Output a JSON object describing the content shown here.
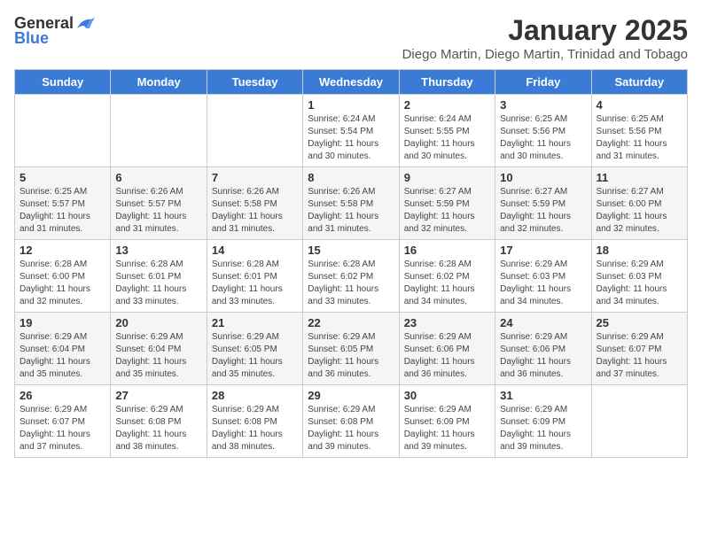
{
  "header": {
    "logo_general": "General",
    "logo_blue": "Blue",
    "month_title": "January 2025",
    "location": "Diego Martin, Diego Martin, Trinidad and Tobago"
  },
  "days_of_week": [
    "Sunday",
    "Monday",
    "Tuesday",
    "Wednesday",
    "Thursday",
    "Friday",
    "Saturday"
  ],
  "weeks": [
    [
      {
        "day": "",
        "info": ""
      },
      {
        "day": "",
        "info": ""
      },
      {
        "day": "",
        "info": ""
      },
      {
        "day": "1",
        "info": "Sunrise: 6:24 AM\nSunset: 5:54 PM\nDaylight: 11 hours and 30 minutes."
      },
      {
        "day": "2",
        "info": "Sunrise: 6:24 AM\nSunset: 5:55 PM\nDaylight: 11 hours and 30 minutes."
      },
      {
        "day": "3",
        "info": "Sunrise: 6:25 AM\nSunset: 5:56 PM\nDaylight: 11 hours and 30 minutes."
      },
      {
        "day": "4",
        "info": "Sunrise: 6:25 AM\nSunset: 5:56 PM\nDaylight: 11 hours and 31 minutes."
      }
    ],
    [
      {
        "day": "5",
        "info": "Sunrise: 6:25 AM\nSunset: 5:57 PM\nDaylight: 11 hours and 31 minutes."
      },
      {
        "day": "6",
        "info": "Sunrise: 6:26 AM\nSunset: 5:57 PM\nDaylight: 11 hours and 31 minutes."
      },
      {
        "day": "7",
        "info": "Sunrise: 6:26 AM\nSunset: 5:58 PM\nDaylight: 11 hours and 31 minutes."
      },
      {
        "day": "8",
        "info": "Sunrise: 6:26 AM\nSunset: 5:58 PM\nDaylight: 11 hours and 31 minutes."
      },
      {
        "day": "9",
        "info": "Sunrise: 6:27 AM\nSunset: 5:59 PM\nDaylight: 11 hours and 32 minutes."
      },
      {
        "day": "10",
        "info": "Sunrise: 6:27 AM\nSunset: 5:59 PM\nDaylight: 11 hours and 32 minutes."
      },
      {
        "day": "11",
        "info": "Sunrise: 6:27 AM\nSunset: 6:00 PM\nDaylight: 11 hours and 32 minutes."
      }
    ],
    [
      {
        "day": "12",
        "info": "Sunrise: 6:28 AM\nSunset: 6:00 PM\nDaylight: 11 hours and 32 minutes."
      },
      {
        "day": "13",
        "info": "Sunrise: 6:28 AM\nSunset: 6:01 PM\nDaylight: 11 hours and 33 minutes."
      },
      {
        "day": "14",
        "info": "Sunrise: 6:28 AM\nSunset: 6:01 PM\nDaylight: 11 hours and 33 minutes."
      },
      {
        "day": "15",
        "info": "Sunrise: 6:28 AM\nSunset: 6:02 PM\nDaylight: 11 hours and 33 minutes."
      },
      {
        "day": "16",
        "info": "Sunrise: 6:28 AM\nSunset: 6:02 PM\nDaylight: 11 hours and 34 minutes."
      },
      {
        "day": "17",
        "info": "Sunrise: 6:29 AM\nSunset: 6:03 PM\nDaylight: 11 hours and 34 minutes."
      },
      {
        "day": "18",
        "info": "Sunrise: 6:29 AM\nSunset: 6:03 PM\nDaylight: 11 hours and 34 minutes."
      }
    ],
    [
      {
        "day": "19",
        "info": "Sunrise: 6:29 AM\nSunset: 6:04 PM\nDaylight: 11 hours and 35 minutes."
      },
      {
        "day": "20",
        "info": "Sunrise: 6:29 AM\nSunset: 6:04 PM\nDaylight: 11 hours and 35 minutes."
      },
      {
        "day": "21",
        "info": "Sunrise: 6:29 AM\nSunset: 6:05 PM\nDaylight: 11 hours and 35 minutes."
      },
      {
        "day": "22",
        "info": "Sunrise: 6:29 AM\nSunset: 6:05 PM\nDaylight: 11 hours and 36 minutes."
      },
      {
        "day": "23",
        "info": "Sunrise: 6:29 AM\nSunset: 6:06 PM\nDaylight: 11 hours and 36 minutes."
      },
      {
        "day": "24",
        "info": "Sunrise: 6:29 AM\nSunset: 6:06 PM\nDaylight: 11 hours and 36 minutes."
      },
      {
        "day": "25",
        "info": "Sunrise: 6:29 AM\nSunset: 6:07 PM\nDaylight: 11 hours and 37 minutes."
      }
    ],
    [
      {
        "day": "26",
        "info": "Sunrise: 6:29 AM\nSunset: 6:07 PM\nDaylight: 11 hours and 37 minutes."
      },
      {
        "day": "27",
        "info": "Sunrise: 6:29 AM\nSunset: 6:08 PM\nDaylight: 11 hours and 38 minutes."
      },
      {
        "day": "28",
        "info": "Sunrise: 6:29 AM\nSunset: 6:08 PM\nDaylight: 11 hours and 38 minutes."
      },
      {
        "day": "29",
        "info": "Sunrise: 6:29 AM\nSunset: 6:08 PM\nDaylight: 11 hours and 39 minutes."
      },
      {
        "day": "30",
        "info": "Sunrise: 6:29 AM\nSunset: 6:09 PM\nDaylight: 11 hours and 39 minutes."
      },
      {
        "day": "31",
        "info": "Sunrise: 6:29 AM\nSunset: 6:09 PM\nDaylight: 11 hours and 39 minutes."
      },
      {
        "day": "",
        "info": ""
      }
    ]
  ]
}
